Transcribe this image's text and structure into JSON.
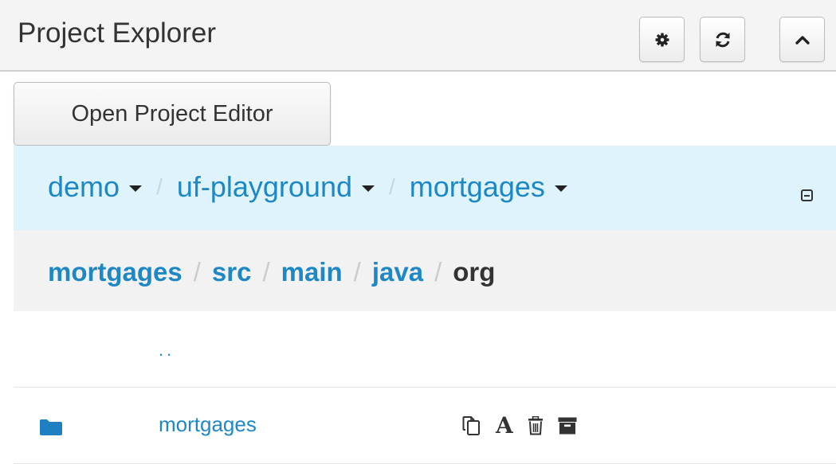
{
  "header": {
    "title": "Project Explorer",
    "buttons": [
      {
        "icon": "gear-icon"
      },
      {
        "icon": "refresh-icon"
      },
      {
        "icon": "chevron-up-icon"
      }
    ]
  },
  "open_editor_label": "Open Project Editor",
  "repo_breadcrumb": {
    "items": [
      {
        "label": "demo",
        "icon": "caret-down-icon"
      },
      {
        "label": "uf-playground",
        "icon": "caret-down-icon"
      },
      {
        "label": "mortgages",
        "icon": "caret-down-icon"
      }
    ],
    "separator": "/",
    "collapse_icon": "minus-square-icon"
  },
  "path_breadcrumb": {
    "items": [
      "mortgages",
      "src",
      "main",
      "java"
    ],
    "current": "org",
    "separator": "/"
  },
  "files": {
    "parent_label": "..",
    "rows": [
      {
        "name": "mortgages",
        "icon": "folder-icon",
        "actions": [
          "copy-icon",
          "rename-icon",
          "delete-icon",
          "archive-icon"
        ],
        "rename_glyph": "A"
      }
    ]
  },
  "colors": {
    "link": "#1e88c6",
    "repo_bar_bg": "#def3fb",
    "path_bar_bg": "#f2f2f2",
    "header_bg": "#f4f4f4"
  }
}
